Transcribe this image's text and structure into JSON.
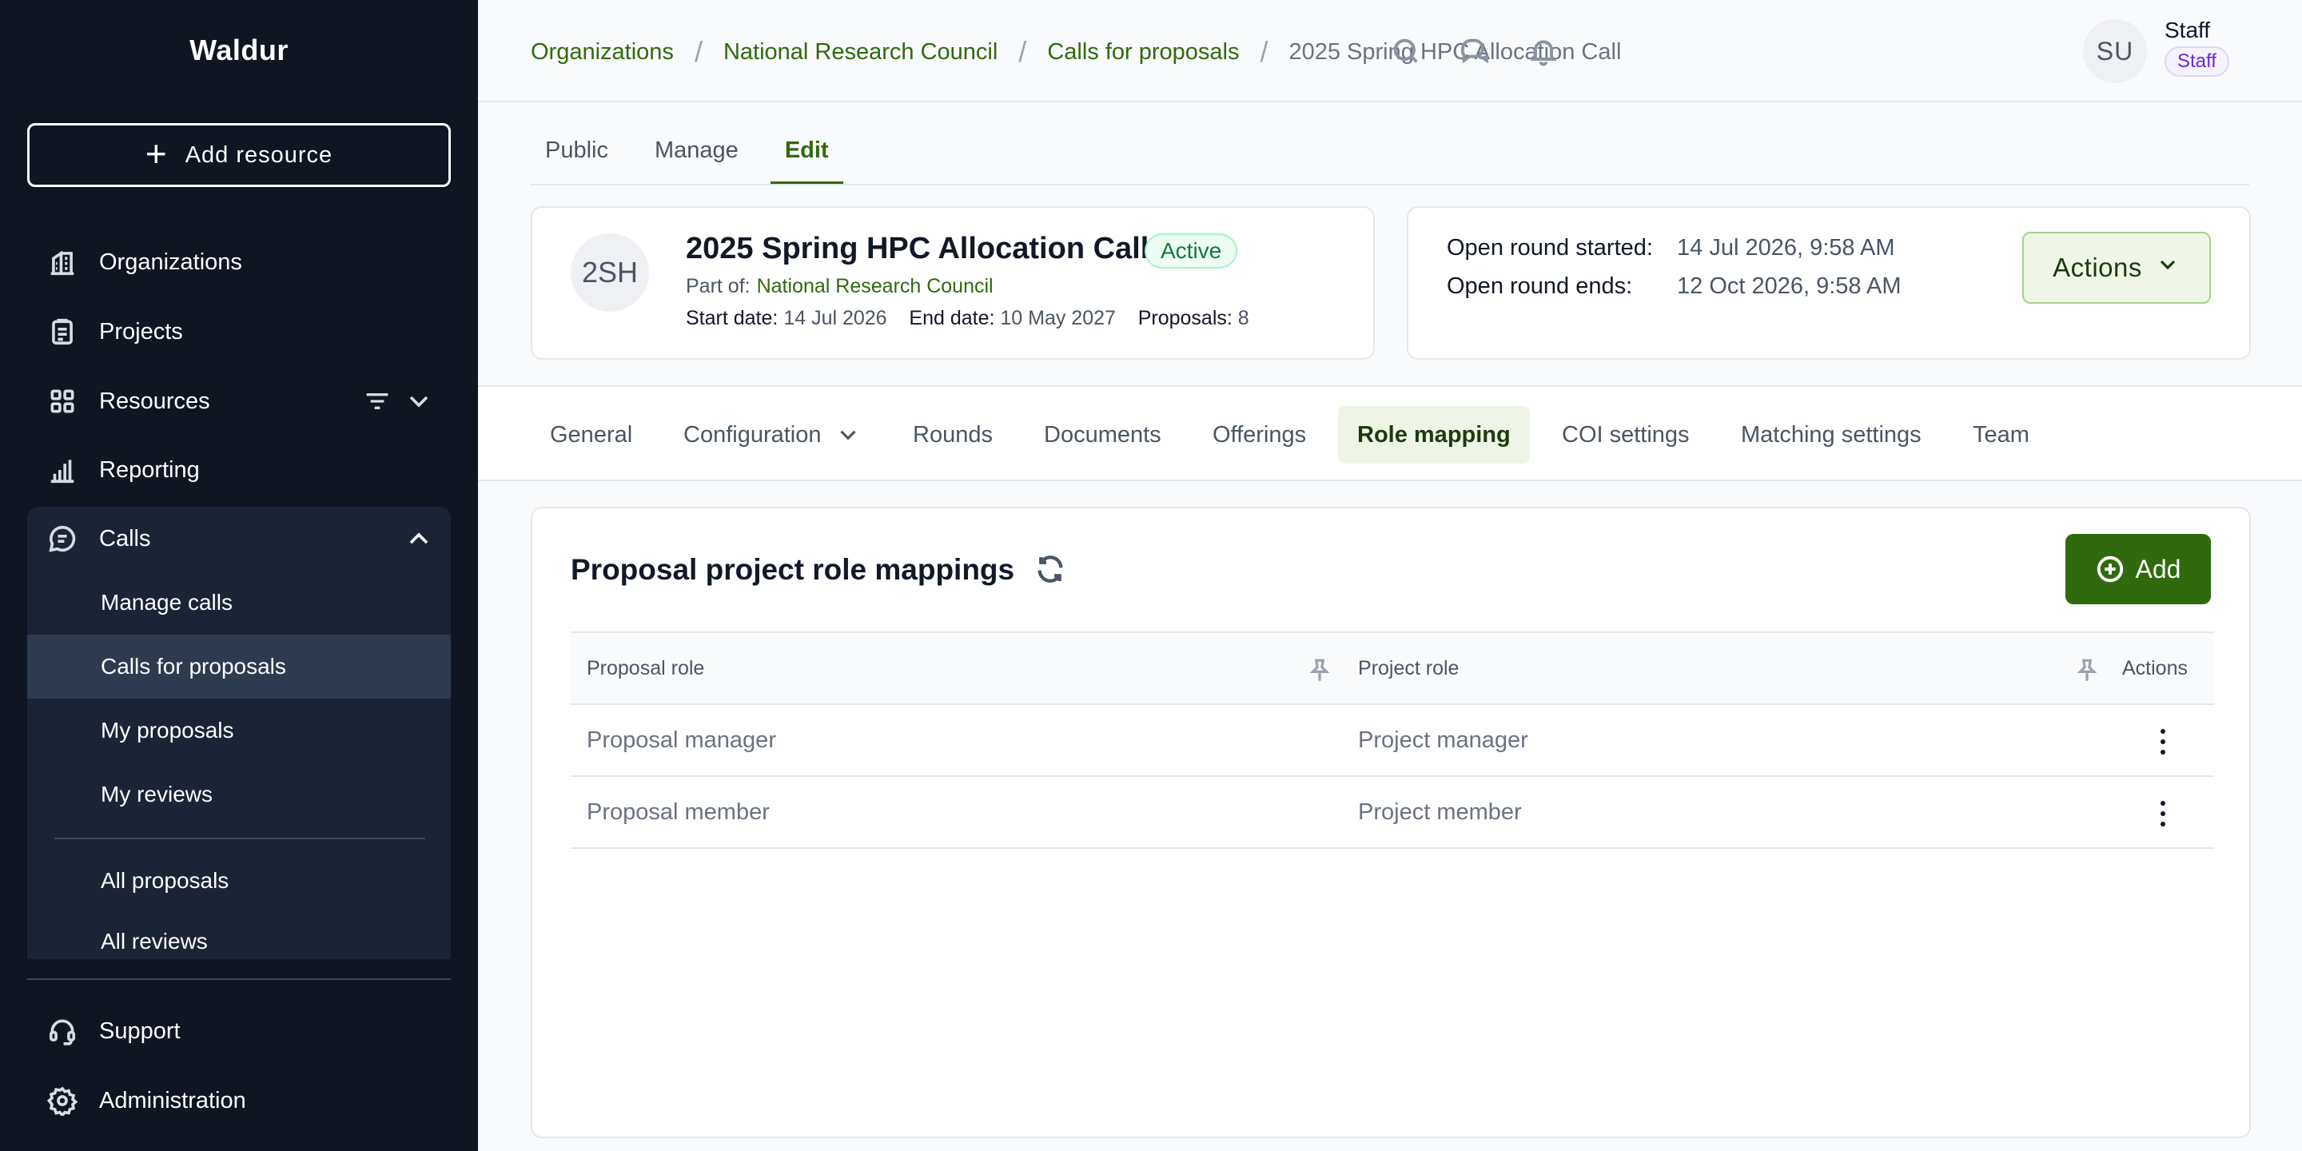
{
  "sidebar": {
    "brand": "Waldur",
    "add_resource_label": "Add resource",
    "items": [
      {
        "label": "Organizations",
        "icon": "building-icon"
      },
      {
        "label": "Projects",
        "icon": "clipboard-icon"
      },
      {
        "label": "Resources",
        "icon": "grid-icon"
      },
      {
        "label": "Reporting",
        "icon": "bar-chart-icon"
      },
      {
        "label": "Calls",
        "icon": "chat-icon"
      }
    ],
    "calls_submenu": [
      "Manage calls",
      "Calls for proposals",
      "My proposals",
      "My reviews",
      "All proposals",
      "All reviews"
    ],
    "active_submenu": "Calls for proposals",
    "bottom_items": [
      {
        "label": "Support",
        "icon": "headset-icon"
      },
      {
        "label": "Administration",
        "icon": "gear-icon"
      }
    ]
  },
  "header": {
    "breadcrumbs": [
      "Organizations",
      "National Research Council",
      "Calls for proposals"
    ],
    "current": "2025 Spring HPC Allocation Call",
    "icons": [
      "search-icon",
      "chat-icon",
      "bell-icon"
    ],
    "user": {
      "initials": "SU",
      "name": "Staff",
      "badge": "Staff"
    }
  },
  "top_tabs": [
    "Public",
    "Manage",
    "Edit"
  ],
  "active_top_tab": "Edit",
  "call": {
    "initials": "2SH",
    "title": "2025 Spring HPC Allocation Call",
    "status": "Active",
    "part_of_label": "Part of:",
    "part_of": "National Research Council",
    "start_label": "Start date:",
    "start": "14 Jul 2026",
    "end_label": "End date:",
    "end": "10 May 2027",
    "proposals_label": "Proposals:",
    "proposals": "8",
    "round_started_label": "Open round started:",
    "round_started": "14 Jul 2026, 9:58 AM",
    "round_ends_label": "Open round ends:",
    "round_ends": "12 Oct 2026, 9:58 AM",
    "actions_label": "Actions"
  },
  "section_tabs": [
    "General",
    "Configuration",
    "Rounds",
    "Documents",
    "Offerings",
    "Role mapping",
    "COI settings",
    "Matching settings",
    "Team"
  ],
  "active_section_tab": "Role mapping",
  "mappings": {
    "title": "Proposal project role mappings",
    "add_label": "Add",
    "columns": [
      "Proposal role",
      "Project role",
      "Actions"
    ],
    "rows": [
      {
        "proposal_role": "Proposal manager",
        "project_role": "Project manager"
      },
      {
        "proposal_role": "Proposal member",
        "project_role": "Project member"
      }
    ]
  },
  "colors": {
    "sidebar_bg": "#0f1521",
    "accent": "#2f6a0e",
    "active_tab_bg": "#eef5e7",
    "status_green": "#0f7a3a",
    "staff_badge": "#6d28d9"
  }
}
